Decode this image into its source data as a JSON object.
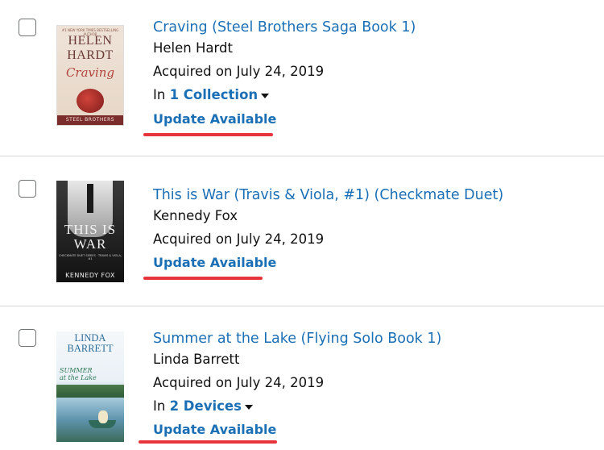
{
  "items": [
    {
      "title": "Craving (Steel Brothers Saga Book 1)",
      "author": "Helen Hardt",
      "acquired": "Acquired on July 24, 2019",
      "in_prefix": "In",
      "in_link": "1 Collection",
      "update_label": "Update Available",
      "cover": {
        "top_text": "#1 NEW YORK TIMES BESTSELLING AUTHOR",
        "author_first": "HELEN",
        "author_last": "HARDT",
        "title": "Craving",
        "series": "STEEL BROTHERS"
      }
    },
    {
      "title": "This is War (Travis & Viola, #1) (Checkmate Duet)",
      "author": "Kennedy Fox",
      "acquired": "Acquired on July 24, 2019",
      "update_label": "Update Available",
      "cover": {
        "title_line1": "THIS IS",
        "title_line2": "WAR",
        "series": "CHECKMATE DUET SERIES · TRAVIS & VIOLA, #1",
        "author": "KENNEDY FOX"
      }
    },
    {
      "title": "Summer at the Lake (Flying Solo Book 1)",
      "author": "Linda Barrett",
      "acquired": "Acquired on July 24, 2019",
      "in_prefix": "In",
      "in_link": "2 Devices",
      "update_label": "Update Available",
      "cover": {
        "author_first": "LINDA",
        "author_last": "BARRETT",
        "title_line1": "SUMMER",
        "title_line2": "at the Lake"
      }
    }
  ],
  "colors": {
    "link": "#1a6fb5",
    "highlight": "#e8343c",
    "divider": "#d5d9d9"
  }
}
